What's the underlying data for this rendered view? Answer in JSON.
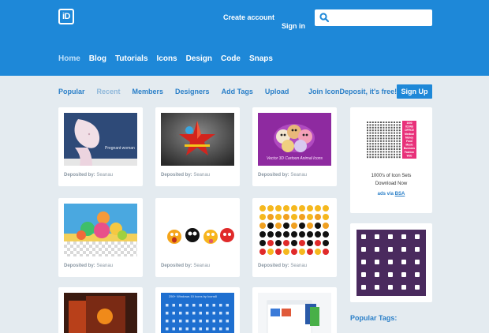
{
  "header": {
    "logo_text": "iD",
    "create_account": "Create account",
    "sign_in": "Sign in",
    "search": {
      "placeholder": "",
      "value": ""
    },
    "nav": [
      "Home",
      "Blog",
      "Tutorials",
      "Icons",
      "Design",
      "Code",
      "Snaps"
    ],
    "active_nav": "Home",
    "brand_color": "#1e88d8"
  },
  "subnav": {
    "items": [
      "Popular",
      "Recent",
      "Members",
      "Designers",
      "Add Tags",
      "Upload"
    ],
    "muted": "Recent",
    "join_text": "Join IconDeposit, it's free!",
    "signup_label": "Sign Up"
  },
  "cards": [
    {
      "caption_prefix": "Deposited by:",
      "author": "Seanau",
      "thumb_text": "Pregnant woman"
    },
    {
      "caption_prefix": "Deposited by:",
      "author": "Seanau",
      "thumb_text": ""
    },
    {
      "caption_prefix": "Deposited by:",
      "author": "Seanau",
      "thumb_text": "Vector 3D Cartoon Animal Icons"
    },
    {
      "caption_prefix": "Deposited by:",
      "author": "Seanau",
      "thumb_text": ""
    },
    {
      "caption_prefix": "Deposited by:",
      "author": "Seanau",
      "thumb_text": ""
    },
    {
      "caption_prefix": "Deposited by:",
      "author": "Seanau",
      "thumb_text": ""
    },
    {
      "caption_prefix": "",
      "author": "",
      "thumb_text": ""
    },
    {
      "caption_prefix": "",
      "author": "",
      "thumb_text": "250+ Windows 10 Icons by Icons8"
    },
    {
      "caption_prefix": "",
      "author": "",
      "thumb_text": ""
    }
  ],
  "ad": {
    "banner_lines": [
      "1000",
      "ICONS",
      "OFFICE",
      "Medical",
      "Money",
      "Food",
      "Music",
      "Business",
      "Fashion",
      "Web"
    ],
    "title": "1000's of Icon Sets",
    "subtitle": "Download Now",
    "via_prefix": "ads via",
    "via_link": "BSA"
  },
  "sidebar": {
    "popular_tags": "Popular Tags:"
  }
}
